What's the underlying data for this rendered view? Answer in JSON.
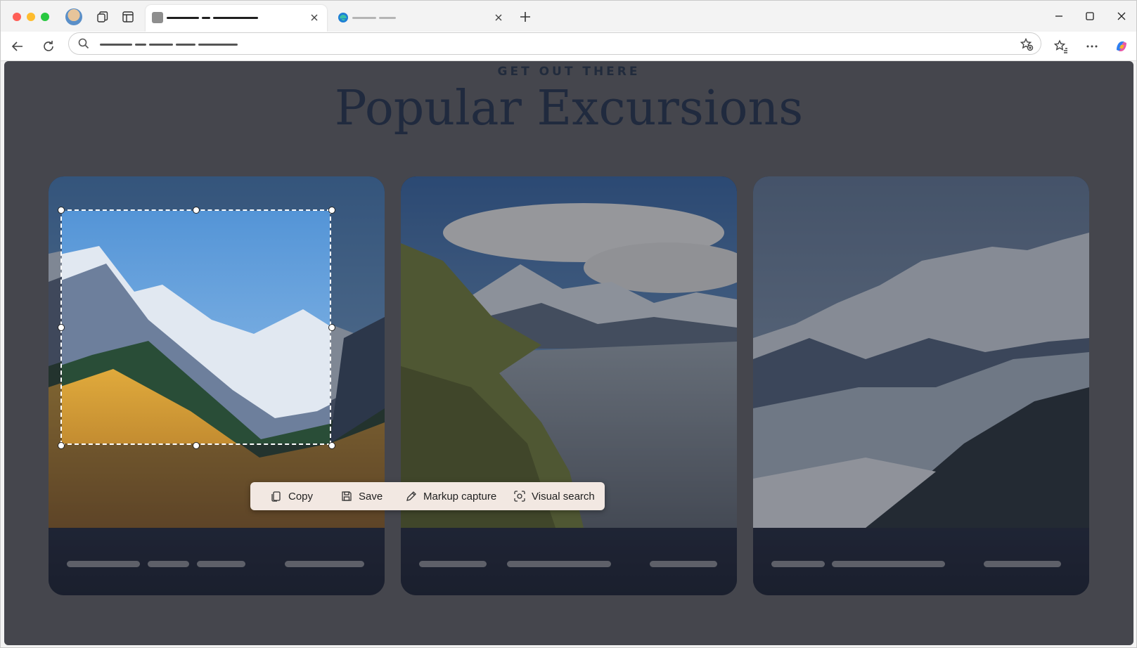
{
  "browser": {
    "tabs": [
      {
        "label": "",
        "state": "active"
      },
      {
        "label": "",
        "state": "inactive"
      }
    ],
    "address_placeholder": "",
    "icons": [
      "profile-avatar",
      "workspaces-icon",
      "tab-actions-icon",
      "close-icon",
      "new-tab-icon",
      "minimize-icon",
      "maximize-icon",
      "back-icon",
      "refresh-icon",
      "search-icon",
      "add-favorite-icon",
      "favorites-icon",
      "more-icon",
      "copilot-icon"
    ]
  },
  "page": {
    "kicker": "GET OUT THERE",
    "headline": "Popular Excursions",
    "cards": [
      {
        "name": "card-autumn-peaks"
      },
      {
        "name": "card-alpine-lake"
      },
      {
        "name": "card-snowy-ridges"
      }
    ]
  },
  "capture_menu": {
    "copy_label": "Copy",
    "save_label": "Save",
    "markup_label": "Markup capture",
    "visual_search_label": "Visual search"
  },
  "colors": {
    "headline": "#1b2a47",
    "overlay": "#5d5d63",
    "menu_bg": "#f2e8e2"
  }
}
